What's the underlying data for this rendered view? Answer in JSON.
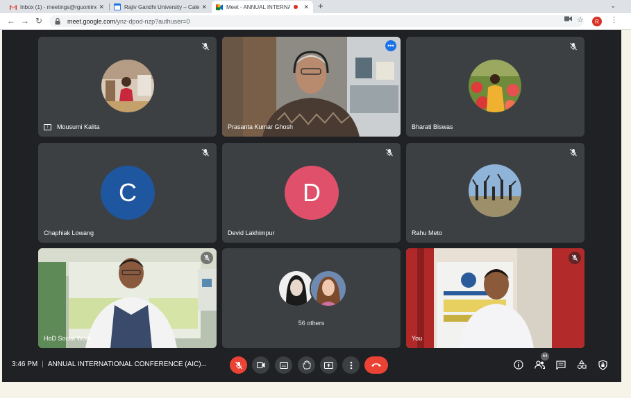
{
  "browser": {
    "tabs": [
      {
        "title": "Inbox (1) - meetings@rguonline.",
        "icon": "gmail-icon"
      },
      {
        "title": "Rajiv Gandhi University – Calen",
        "icon": "calendar-icon"
      },
      {
        "title": "Meet - ANNUAL INTERNAT",
        "icon": "meet-icon",
        "recording": true
      }
    ],
    "url_host": "meet.google.com",
    "url_path": "/ynz-dpod-nzp?authuser=0",
    "profile_initial": "R"
  },
  "participants": [
    {
      "name": "Mousumi Kalita",
      "muted": true,
      "pinned_icon": true
    },
    {
      "name": "Prasanta Kumar Ghosh",
      "muted": false,
      "active_speaker": true
    },
    {
      "name": "Bharati Biswas",
      "muted": true
    },
    {
      "name": "Chaphiak Lowang",
      "muted": true,
      "initial": "C",
      "color": "#1e56a0"
    },
    {
      "name": "Devid Lakhimpur",
      "muted": true,
      "initial": "D",
      "color": "#e0506a"
    },
    {
      "name": "Rahu Meto",
      "muted": true
    },
    {
      "name": "HoD Social Work",
      "muted": true
    },
    {
      "name": "You",
      "muted": true
    }
  ],
  "others": {
    "label": "56 others"
  },
  "meeting": {
    "time": "3:46 PM",
    "separator": "|",
    "title": "ANNUAL INTERNATIONAL CONFERENCE (AIC)..."
  },
  "people_count": "64",
  "colors": {
    "meet_bg": "#202124",
    "tile_bg": "#3c4043",
    "danger": "#ea4335",
    "active_outline": "#8ab4f8"
  }
}
